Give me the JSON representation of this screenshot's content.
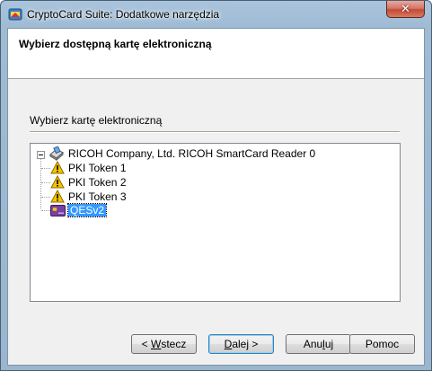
{
  "window": {
    "title": "CryptoCard Suite: Dodatkowe narzędzia",
    "close_glyph": "✕"
  },
  "header": {
    "title": "Wybierz dostępną kartę elektroniczną"
  },
  "section": {
    "label": "Wybierz kartę elektroniczną"
  },
  "tree": {
    "reader": {
      "label": "RICOH Company, Ltd. RICOH SmartCard Reader 0",
      "icon": "card-reader-icon",
      "expanded": true
    },
    "items": [
      {
        "label": "PKI Token 1",
        "icon": "warning-icon",
        "selected": false
      },
      {
        "label": "PKI Token 2",
        "icon": "warning-icon",
        "selected": false
      },
      {
        "label": "PKI Token 3",
        "icon": "warning-icon",
        "selected": false
      },
      {
        "label": "QESv2",
        "icon": "smartcard-icon",
        "selected": true
      }
    ]
  },
  "buttons": {
    "back": {
      "prefix": "< ",
      "mnemonic": "W",
      "rest": "stecz"
    },
    "next": {
      "mnemonic": "D",
      "rest": "alej >"
    },
    "cancel": {
      "mnemonic": "",
      "pre": "Anu",
      "mn": "l",
      "post": "uj"
    },
    "help": {
      "label": "Pomoc"
    }
  },
  "colors": {
    "selection": "#3399ff",
    "warning": "#f5c400",
    "card": "#7b3fa8"
  }
}
